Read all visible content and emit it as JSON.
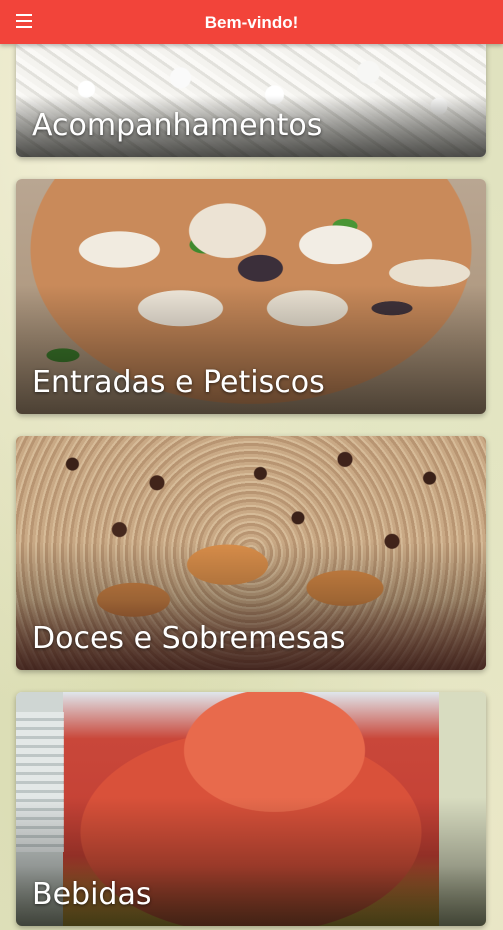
{
  "toolbar": {
    "title": "Bem-vindo!",
    "menu_icon": "hamburger-menu-icon",
    "color": "#f2443a"
  },
  "categories": [
    {
      "label": "Acompanhamentos"
    },
    {
      "label": "Entradas e Petiscos"
    },
    {
      "label": "Doces e Sobremesas"
    },
    {
      "label": "Bebidas"
    }
  ]
}
